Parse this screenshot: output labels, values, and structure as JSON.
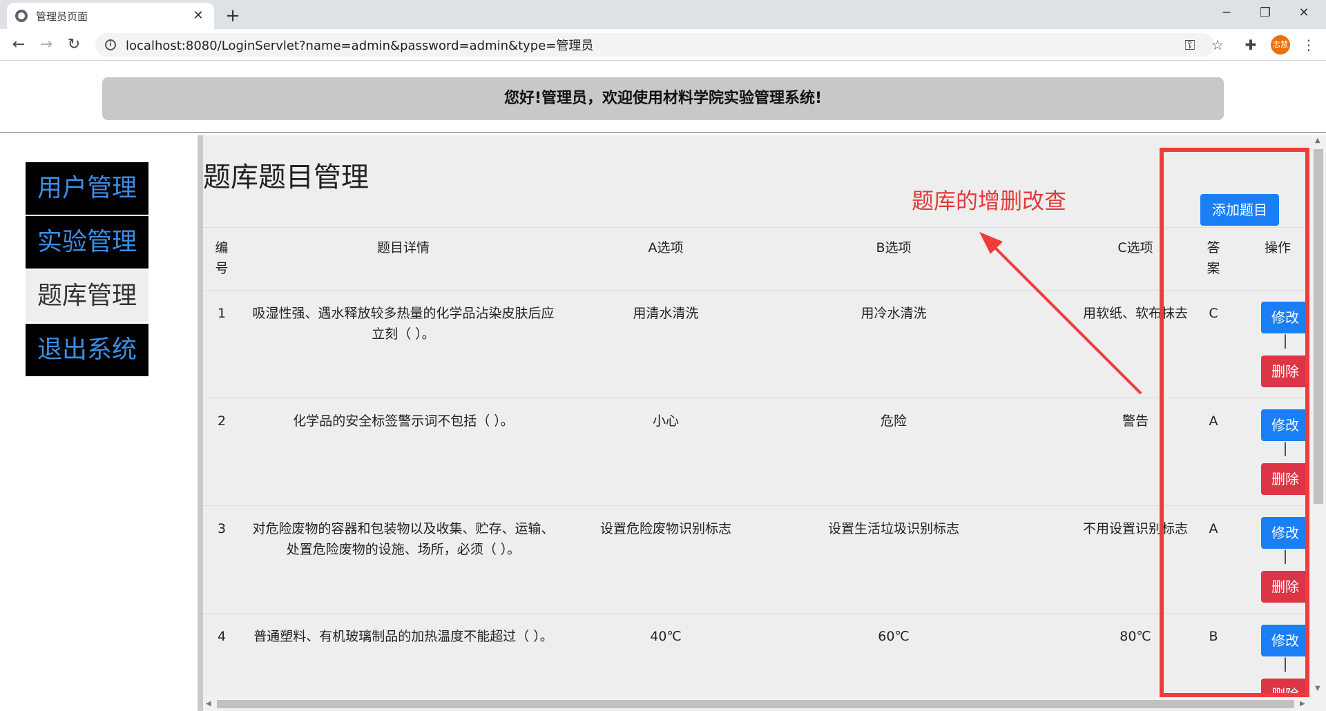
{
  "browser": {
    "tab_title": "管理员页面",
    "url": "localhost:8080/LoginServlet?name=admin&password=admin&type=管理员",
    "profile_label": "志慧"
  },
  "header": {
    "welcome": "您好!管理员，欢迎使用材料学院实验管理系统!"
  },
  "sidebar": {
    "items": [
      {
        "label": "用户管理"
      },
      {
        "label": "实验管理"
      },
      {
        "label": "题库管理"
      },
      {
        "label": "退出系统"
      }
    ],
    "active_index": 2
  },
  "main": {
    "title": "题库题目管理",
    "annotation": "题库的增删改查",
    "add_button": "添加题目",
    "columns": [
      "编号",
      "题目详情",
      "A选项",
      "B选项",
      "C选项",
      "答案",
      "操作"
    ],
    "column_display": {
      "id": "编\n号",
      "answer": "答\n案"
    },
    "edit_label": "修改",
    "delete_label": "删除",
    "separator": "|",
    "rows": [
      {
        "id": "1",
        "question": "吸湿性强、遇水释放较多热量的化学品沾染皮肤后应立刻（ ）。",
        "a": "用清水清洗",
        "b": "用冷水清洗",
        "c": "用软纸、软布抹去",
        "answer": "C"
      },
      {
        "id": "2",
        "question": "化学品的安全标签警示词不包括（ ）。",
        "a": "小心",
        "b": "危险",
        "c": "警告",
        "answer": "A"
      },
      {
        "id": "3",
        "question": "对危险废物的容器和包装物以及收集、贮存、运输、处置危险废物的设施、场所，必须（ ）。",
        "a": "设置危险废物识别标志",
        "b": "设置生活垃圾识别标志",
        "c": "不用设置识别标志",
        "answer": "A"
      },
      {
        "id": "4",
        "question": "普通塑料、有机玻璃制品的加热温度不能超过（ ）。",
        "a": "40℃",
        "b": "60℃",
        "c": "80℃",
        "answer": "B"
      }
    ]
  }
}
